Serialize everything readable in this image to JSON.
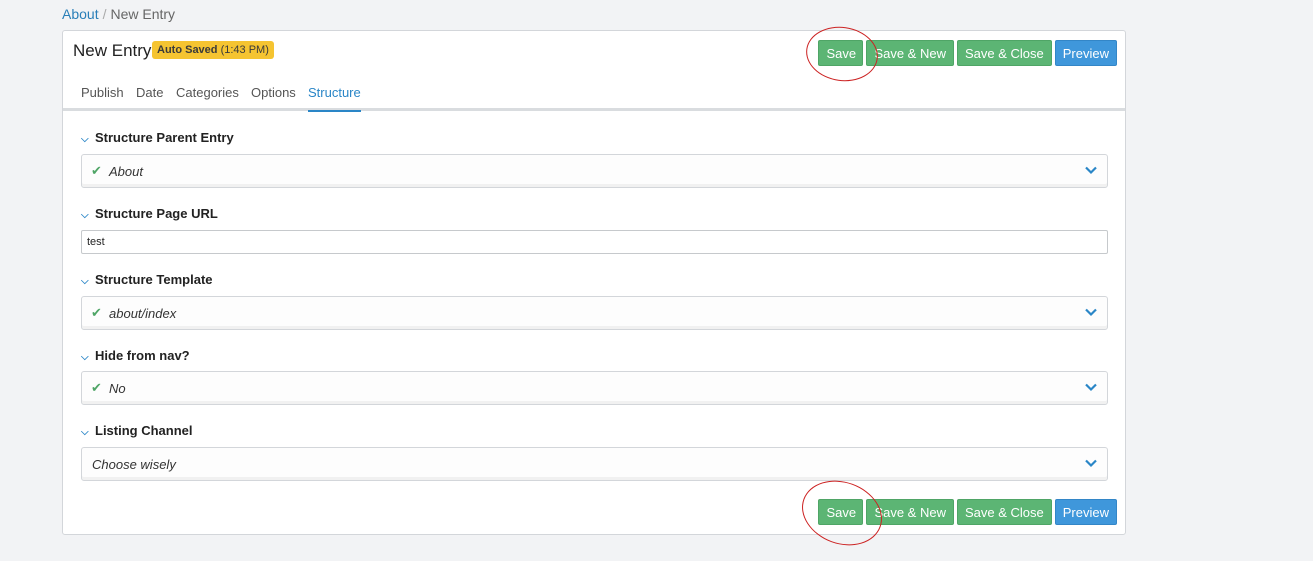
{
  "breadcrumb": {
    "parent": "About",
    "separator": "/",
    "current": "New Entry"
  },
  "panel": {
    "title": "New Entry",
    "autosave_label": "Auto Saved",
    "autosave_time": "(1:43 PM)"
  },
  "actions": {
    "save": "Save",
    "save_new": "Save & New",
    "save_close": "Save & Close",
    "preview": "Preview"
  },
  "tabs": [
    "Publish",
    "Date",
    "Categories",
    "Options",
    "Structure"
  ],
  "active_tab": "Structure",
  "fields": {
    "parent_entry": {
      "label": "Structure Parent Entry",
      "value": "About"
    },
    "page_url": {
      "label": "Structure Page URL",
      "value": "test"
    },
    "template": {
      "label": "Structure Template",
      "value": "about/index"
    },
    "hide_nav": {
      "label": "Hide from nav?",
      "value": "No"
    },
    "listing_channel": {
      "label": "Listing Channel",
      "value": "Choose wisely"
    }
  },
  "colors": {
    "save_green": "#5cb574",
    "preview_blue": "#3f97db",
    "autosave_yellow": "#f5c431",
    "annotation_red": "#cc2222",
    "link_blue": "#2a86c7"
  }
}
